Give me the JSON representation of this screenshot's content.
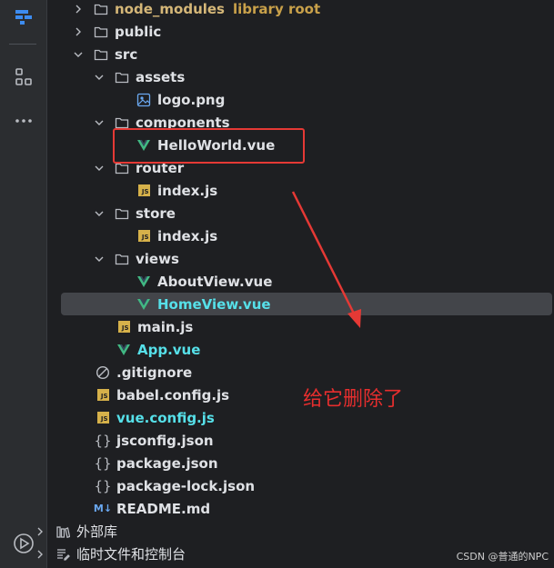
{
  "activity_bar": {
    "items": [
      {
        "icon": "project-icon"
      },
      {
        "icon": "structure-icon"
      },
      {
        "icon": "more-icon"
      },
      {
        "icon": "run-icon"
      }
    ]
  },
  "tree": {
    "rows": [
      {
        "label": "node_modules",
        "hint": "library root",
        "icon": "folder-icon",
        "expand": "collapsed",
        "style": "yellow"
      },
      {
        "label": "public",
        "icon": "folder-icon",
        "expand": "collapsed"
      },
      {
        "label": "src",
        "icon": "folder-icon",
        "expand": "expanded"
      },
      {
        "label": "assets",
        "icon": "folder-icon",
        "expand": "expanded"
      },
      {
        "label": "logo.png",
        "icon": "image-icon"
      },
      {
        "label": "components",
        "icon": "folder-icon",
        "expand": "expanded"
      },
      {
        "label": "HelloWorld.vue",
        "icon": "vue-icon"
      },
      {
        "label": "router",
        "icon": "folder-icon",
        "expand": "expanded"
      },
      {
        "label": "index.js",
        "icon": "js-icon"
      },
      {
        "label": "store",
        "icon": "folder-icon",
        "expand": "expanded"
      },
      {
        "label": "index.js",
        "icon": "js-icon"
      },
      {
        "label": "views",
        "icon": "folder-icon",
        "expand": "expanded"
      },
      {
        "label": "AboutView.vue",
        "icon": "vue-icon"
      },
      {
        "label": "HomeView.vue",
        "icon": "vue-icon",
        "selected": true,
        "style": "cyan"
      },
      {
        "label": "main.js",
        "icon": "js-icon"
      },
      {
        "label": "App.vue",
        "icon": "vue-icon",
        "style": "cyan"
      },
      {
        "label": ".gitignore",
        "icon": "ignore-icon"
      },
      {
        "label": "babel.config.js",
        "icon": "js-icon"
      },
      {
        "label": "vue.config.js",
        "icon": "js-icon",
        "style": "cyan"
      },
      {
        "label": "jsconfig.json",
        "icon": "json-icon"
      },
      {
        "label": "package.json",
        "icon": "json-icon"
      },
      {
        "label": "package-lock.json",
        "icon": "json-icon"
      },
      {
        "label": "README.md",
        "icon": "markdown-icon"
      },
      {
        "label": "外部库",
        "icon": "library-icon",
        "expand": "collapsed",
        "style": "plain"
      },
      {
        "label": "临时文件和控制台",
        "icon": "scratches-icon",
        "expand": "collapsed",
        "style": "plain"
      }
    ]
  },
  "annotation": {
    "text": "给它删除了"
  },
  "watermark": "CSDN @普通的NPC",
  "colors": {
    "background": "#1e1f22",
    "selection": "#43454a",
    "annotation": "#e62e2e",
    "vue": "#41b883",
    "js": "#d6b14a"
  }
}
